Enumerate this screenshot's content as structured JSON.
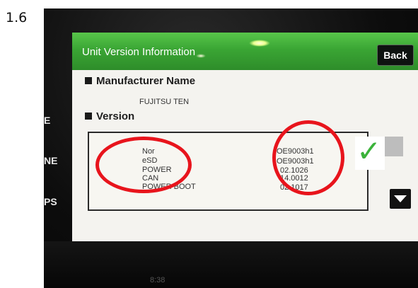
{
  "step_number": "1.6",
  "side_labels": [
    "E",
    "NE",
    "PS"
  ],
  "screen": {
    "title": "Unit Version Information",
    "back_label": "Back",
    "manufacturer": {
      "heading": "Manufacturer Name",
      "value": "FUJITSU TEN"
    },
    "version": {
      "heading": "Version",
      "rows": [
        {
          "label": "Nor",
          "value": "OE9003h1"
        },
        {
          "label": "eSD",
          "value": "OE9003h1"
        },
        {
          "label": "POWER",
          "value": "02.1026"
        },
        {
          "label": "CAN",
          "value": "14.0012"
        },
        {
          "label": "POWER BOOT",
          "value": "02.1017"
        }
      ]
    }
  },
  "bottom_text": "8:38",
  "colors": {
    "title_bar": "#3aa534",
    "annotation_circle": "#e8141c",
    "checkmark": "#3bb33a"
  },
  "icons": {
    "checkmark": "check-icon",
    "scroll_down": "arrow-down-icon"
  }
}
